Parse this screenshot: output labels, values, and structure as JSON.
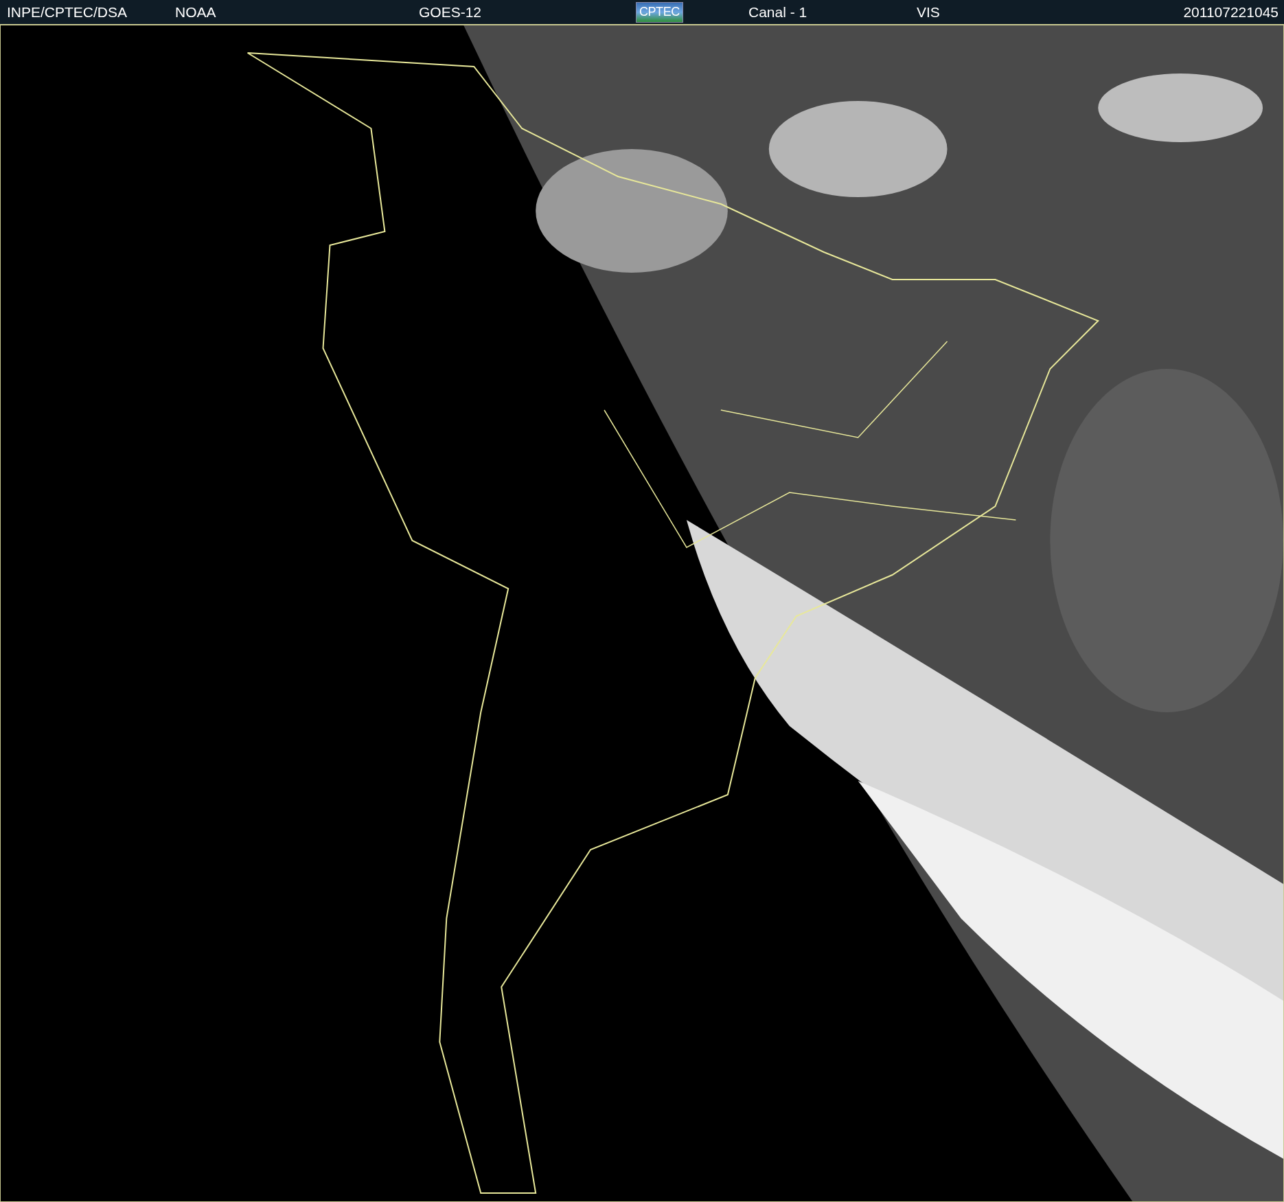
{
  "header": {
    "items": [
      {
        "kind": "text",
        "label": "INPE/CPTEC/DSA"
      },
      {
        "kind": "text",
        "label": "NOAA"
      },
      {
        "kind": "text",
        "label": "GOES-12"
      },
      {
        "kind": "logo",
        "label": "CPTEC"
      },
      {
        "kind": "text",
        "label": "Canal - 1"
      },
      {
        "kind": "text",
        "label": "VIS"
      },
      {
        "kind": "text",
        "label": "201107221045"
      }
    ]
  }
}
